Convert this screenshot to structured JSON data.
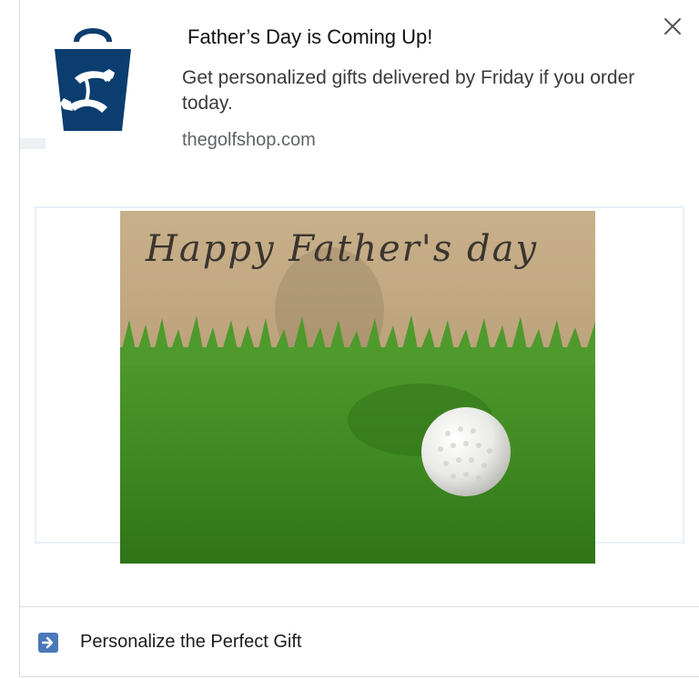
{
  "notification": {
    "title": "Father’s Day is Coming Up!",
    "body": "Get personalized gifts delivered by Friday if you order today.",
    "domain": "thegolfshop.com",
    "close_icon": "close-icon",
    "brand_color": "#0b3d6e"
  },
  "hero": {
    "handwriting": "Happy Father's day"
  },
  "cta": {
    "label": "Personalize the Perfect Gift",
    "icon": "arrow-right-icon",
    "icon_color": "#4a78b8"
  }
}
